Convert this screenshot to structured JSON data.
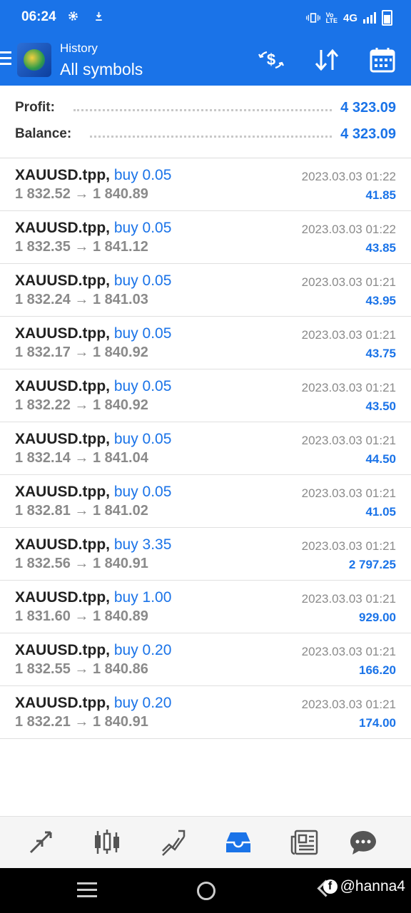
{
  "status_bar": {
    "time": "06:24",
    "network": "4G",
    "icons": [
      "gear-icon",
      "download-icon",
      "vibrate-icon",
      "volte-icon",
      "signal-icon",
      "battery-icon"
    ]
  },
  "header": {
    "subtitle": "History",
    "title": "All symbols",
    "tools": [
      "currency-exchange-icon",
      "sort-icon",
      "calendar-icon"
    ]
  },
  "summary": {
    "profit_label": "Profit:",
    "profit_value": "4 323.09",
    "balance_label": "Balance:",
    "balance_value": "4 323.09"
  },
  "deals": [
    {
      "symbol": "XAUUSD.tpp,",
      "side": "buy 0.05",
      "open": "1 832.52",
      "close": "1 840.89",
      "time": "2023.03.03 01:22",
      "profit": "41.85"
    },
    {
      "symbol": "XAUUSD.tpp,",
      "side": "buy 0.05",
      "open": "1 832.35",
      "close": "1 841.12",
      "time": "2023.03.03 01:22",
      "profit": "43.85"
    },
    {
      "symbol": "XAUUSD.tpp,",
      "side": "buy 0.05",
      "open": "1 832.24",
      "close": "1 841.03",
      "time": "2023.03.03 01:21",
      "profit": "43.95"
    },
    {
      "symbol": "XAUUSD.tpp,",
      "side": "buy 0.05",
      "open": "1 832.17",
      "close": "1 840.92",
      "time": "2023.03.03 01:21",
      "profit": "43.75"
    },
    {
      "symbol": "XAUUSD.tpp,",
      "side": "buy 0.05",
      "open": "1 832.22",
      "close": "1 840.92",
      "time": "2023.03.03 01:21",
      "profit": "43.50"
    },
    {
      "symbol": "XAUUSD.tpp,",
      "side": "buy 0.05",
      "open": "1 832.14",
      "close": "1 841.04",
      "time": "2023.03.03 01:21",
      "profit": "44.50"
    },
    {
      "symbol": "XAUUSD.tpp,",
      "side": "buy 0.05",
      "open": "1 832.81",
      "close": "1 841.02",
      "time": "2023.03.03 01:21",
      "profit": "41.05"
    },
    {
      "symbol": "XAUUSD.tpp,",
      "side": "buy 3.35",
      "open": "1 832.56",
      "close": "1 840.91",
      "time": "2023.03.03 01:21",
      "profit": "2 797.25"
    },
    {
      "symbol": "XAUUSD.tpp,",
      "side": "buy 1.00",
      "open": "1 831.60",
      "close": "1 840.89",
      "time": "2023.03.03 01:21",
      "profit": "929.00"
    },
    {
      "symbol": "XAUUSD.tpp,",
      "side": "buy 0.20",
      "open": "1 832.55",
      "close": "1 840.86",
      "time": "2023.03.03 01:21",
      "profit": "166.20"
    },
    {
      "symbol": "XAUUSD.tpp,",
      "side": "buy 0.20",
      "open": "1 832.21",
      "close": "1 840.91",
      "time": "2023.03.03 01:21",
      "profit": "174.00"
    }
  ],
  "bottom_nav": [
    "quotes-icon",
    "chart-icon",
    "trade-icon",
    "history-icon",
    "news-icon",
    "chat-icon"
  ],
  "active_tab": "history-icon",
  "watermark": "@hanna4",
  "colors": {
    "accent": "#1a73e8",
    "text": "#222222",
    "muted": "#8a8a8a"
  }
}
